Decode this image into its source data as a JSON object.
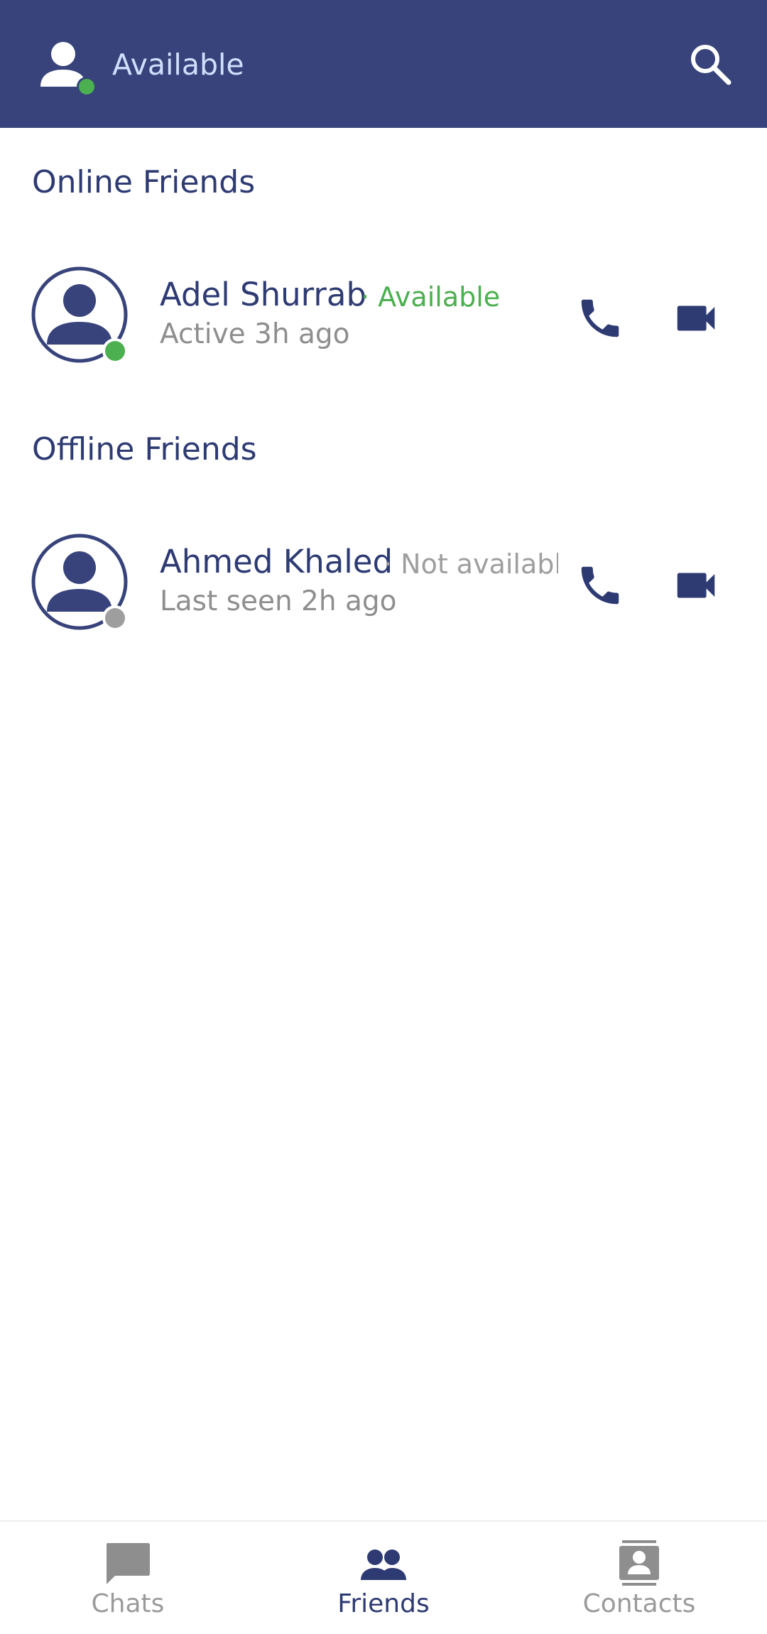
{
  "colors": {
    "brand": "#37437a",
    "online": "#4caf50",
    "offline": "#9e9e9e",
    "text_primary": "#2e3b73",
    "text_secondary": "#8e8e8e"
  },
  "header": {
    "my_status": "Available",
    "icons": {
      "avatar": "person-icon",
      "search": "search-icon"
    }
  },
  "sections": {
    "online_title": "Online Friends",
    "offline_title": "Offline Friends"
  },
  "friends": [
    {
      "name": "Adel Shurrab",
      "availability": "· Available",
      "last_seen": "Active 3h ago",
      "online": true
    },
    {
      "name": "Ahmed Khaled",
      "availability": "· Not available",
      "last_seen": "Last seen 2h ago",
      "online": false
    }
  ],
  "bottom_nav": {
    "items": [
      {
        "label": "Chats",
        "icon": "chat-icon",
        "active": false
      },
      {
        "label": "Friends",
        "icon": "friends-icon",
        "active": true
      },
      {
        "label": "Contacts",
        "icon": "contacts-icon",
        "active": false
      }
    ]
  }
}
